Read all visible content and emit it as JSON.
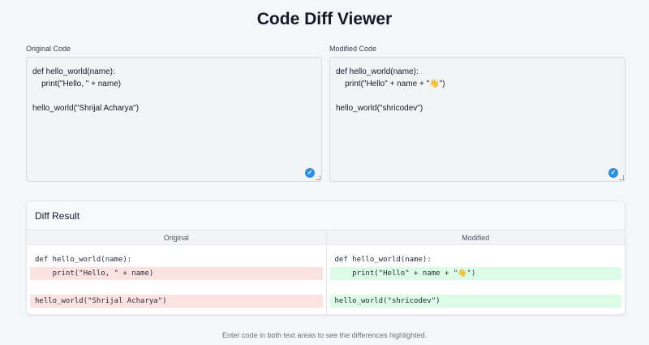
{
  "page": {
    "title": "Code Diff Viewer",
    "footer": "Enter code in both text areas to see the differences highlighted."
  },
  "original": {
    "label": "Original Code",
    "lines": [
      "def hello_world(name):",
      "    print(\"Hello, \" + name)",
      "",
      "hello_world(\"Shrijal Acharya\")"
    ]
  },
  "modified": {
    "label": "Modified Code",
    "lines": [
      "def hello_world(name):",
      "    print(\"Hello\" + name + \"👋\")",
      "",
      "hello_world(\"shricodev\")"
    ]
  },
  "diff": {
    "title": "Diff Result",
    "original_header": "Original",
    "modified_header": "Modified",
    "original_lines": [
      {
        "text": "def hello_world(name):",
        "status": "same"
      },
      {
        "text": "    print(\"Hello, \" + name)",
        "status": "removed"
      },
      {
        "text": "",
        "status": "same"
      },
      {
        "text": "hello_world(\"Shrijal Acharya\")",
        "status": "removed"
      }
    ],
    "modified_lines": [
      {
        "text": "def hello_world(name):",
        "status": "same"
      },
      {
        "text": "    print(\"Hello\" + name + \"👋\")",
        "status": "added"
      },
      {
        "text": "",
        "status": "same"
      },
      {
        "text": "hello_world(\"shricodev\")",
        "status": "added"
      }
    ]
  },
  "icons": {
    "check": "check-circle-icon",
    "resize": "resize-handle-icon"
  },
  "colors": {
    "removed_bg": "#fde2e2",
    "added_bg": "#dcfce7",
    "check_blue": "#2d8ee6"
  }
}
